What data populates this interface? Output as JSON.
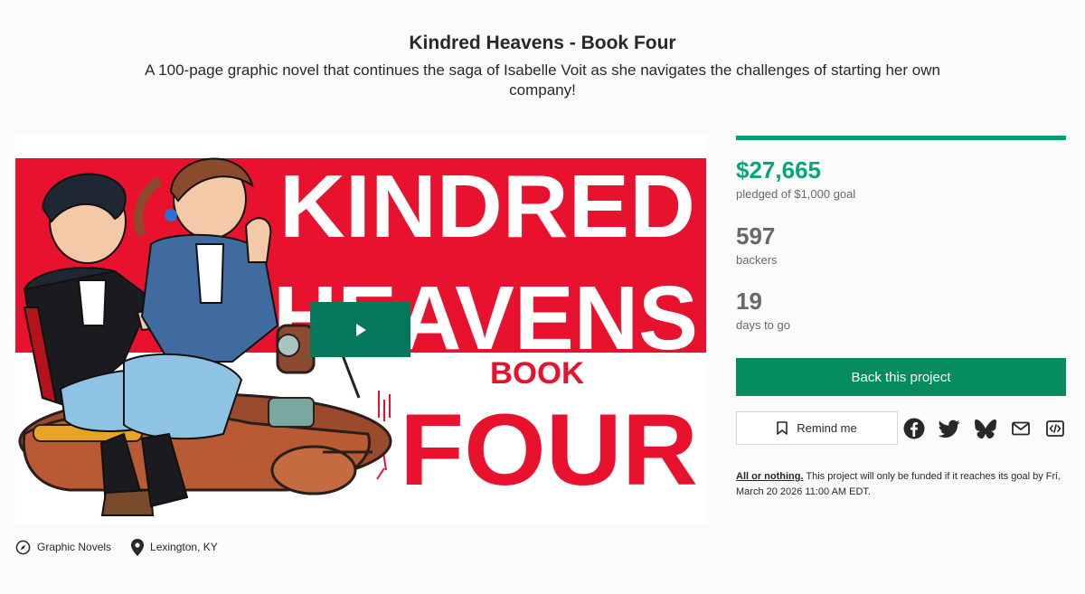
{
  "project": {
    "title": "Kindred Heavens - Book Four",
    "blurb": "A 100-page graphic novel that continues the saga of Isabelle Voit as she navigates the challenges of starting her own company!"
  },
  "media": {
    "artwork_title_line1": "KINDRED",
    "artwork_title_line2": "HEAVENS",
    "artwork_subtitle_line1": "BOOK",
    "artwork_subtitle_line2": "FOUR",
    "play_icon": "play-icon",
    "accent_red": "#e8122e"
  },
  "meta": {
    "category_icon": "compass-icon",
    "category": "Graphic Novels",
    "location_icon": "location-pin-icon",
    "location": "Lexington, KY"
  },
  "stats": {
    "progress_fraction": 1.0,
    "pledged": "$27,665",
    "pledged_label": "pledged of $1,000 goal",
    "backers": "597",
    "backers_label": "backers",
    "days": "19",
    "days_label": "days to go"
  },
  "actions": {
    "back_label": "Back this project",
    "remind_label": "Remind me",
    "remind_icon": "bookmark-icon",
    "share_icons": [
      "facebook-icon",
      "twitter-icon",
      "bluesky-icon",
      "email-icon",
      "embed-icon"
    ]
  },
  "funding": {
    "model_label": "All or nothing.",
    "note": " This project will only be funded if it reaches its goal by Fri, March 20 2026 11:00 AM EDT."
  },
  "colors": {
    "primary_green": "#058c5c",
    "pledged_green": "#05a77a",
    "progress_green": "#059f76",
    "play_green": "#05775a"
  }
}
